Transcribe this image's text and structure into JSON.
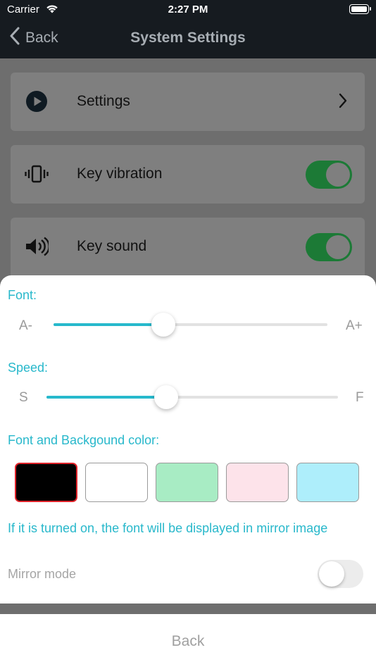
{
  "status_bar": {
    "carrier": "Carrier",
    "time": "2:27 PM"
  },
  "nav": {
    "back_label": "Back",
    "title": "System Settings"
  },
  "list": {
    "items": [
      {
        "label": "Settings",
        "icon": "play-circle-icon",
        "control": "chevron"
      },
      {
        "label": "Key vibration",
        "icon": "vibration-icon",
        "control": "toggle",
        "on": true
      },
      {
        "label": "Key sound",
        "icon": "speaker-icon",
        "control": "toggle",
        "on": true
      }
    ],
    "toggle_on_color": "#1c7a36"
  },
  "sheet": {
    "font": {
      "title": "Font:",
      "min_label": "A-",
      "max_label": "A+",
      "value": 0.4
    },
    "speed": {
      "title": "Speed:",
      "min_label": "S",
      "max_label": "F",
      "value": 0.41
    },
    "color": {
      "title": "Font and Backgound color:",
      "swatches": [
        "#000000",
        "#ffffff",
        "#a8ecc4",
        "#fde3ea",
        "#aeeefb"
      ],
      "selected_index": 0,
      "selected_border": "#e0232a"
    },
    "mirror": {
      "note": "If it is turned on, the font will be displayed in mirror image",
      "label": "Mirror mode",
      "on": false
    },
    "accent": "#27b9cc"
  },
  "bottom": {
    "back_label": "Back"
  }
}
